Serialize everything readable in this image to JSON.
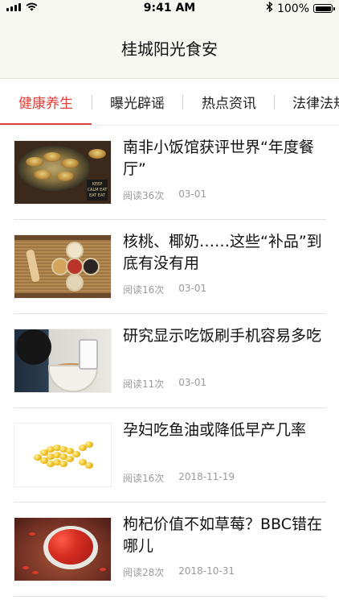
{
  "status_bar": {
    "time": "9:41 AM",
    "battery_text": "100%",
    "battery_level": 1.0,
    "icons": [
      "signal-icon",
      "wifi-icon",
      "bluetooth-icon",
      "battery-icon"
    ]
  },
  "header": {
    "title": "桂城阳光食安"
  },
  "tabs": [
    {
      "label": "健康养生",
      "active": true
    },
    {
      "label": "曝光辟谣",
      "active": false
    },
    {
      "label": "热点资讯",
      "active": false
    },
    {
      "label": "法律法规",
      "active": false
    }
  ],
  "articles": [
    {
      "title": "南非小饭馆获评世界“年度餐厅”",
      "reads": "阅读36次",
      "date": "03-01",
      "thumb_text": "KEEP CALM EAT EAT EAT"
    },
    {
      "title": "核桃、椰奶……这些“补品”到底有没有用",
      "reads": "阅读16次",
      "date": "03-01"
    },
    {
      "title": "研究显示吃饭刷手机容易多吃",
      "reads": "阅读11次",
      "date": "03-01"
    },
    {
      "title": "孕妇吃鱼油或降低早产几率",
      "reads": "阅读16次",
      "date": "2018-11-19"
    },
    {
      "title": "枸杞价值不如草莓？BBC错在哪儿",
      "reads": "阅读28次",
      "date": "2018-10-31"
    }
  ],
  "colors": {
    "accent": "#e0403a",
    "header_bg": "#f7f7f2",
    "meta_text": "#9a9a9a"
  }
}
